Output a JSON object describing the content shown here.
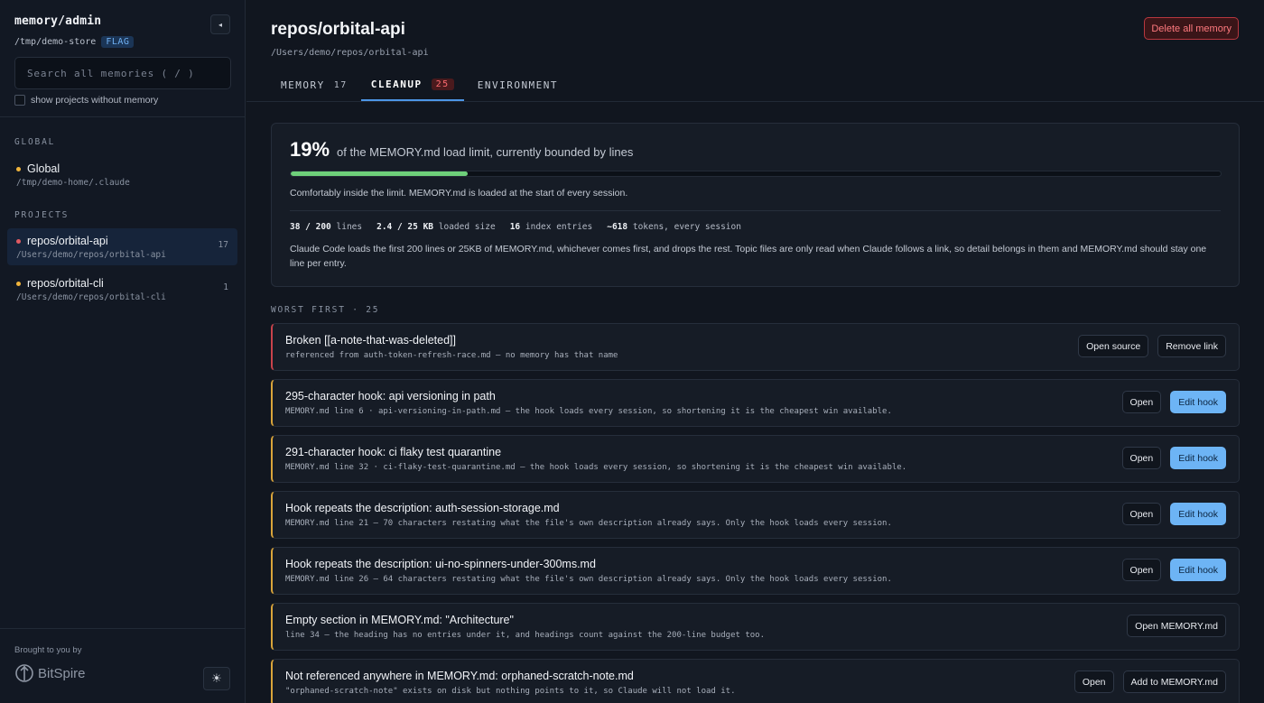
{
  "sidebar": {
    "app_title": "memory/admin",
    "store_path": "/tmp/demo-store",
    "flag_label": "FLAG",
    "collapse_icon": "◂",
    "search_placeholder": "Search all memories  ( / )",
    "show_without_memory_label": "show projects without memory",
    "global_section_label": "GLOBAL",
    "global_item": {
      "name": "Global",
      "path": "/tmp/demo-home/.claude",
      "dot_color": "#f0b43c"
    },
    "projects_section_label": "PROJECTS",
    "projects": [
      {
        "name": "repos/orbital-api",
        "path": "/Users/demo/repos/orbital-api",
        "count": "17",
        "dot_color": "#e05a62",
        "active": true
      },
      {
        "name": "repos/orbital-cli",
        "path": "/Users/demo/repos/orbital-cli",
        "count": "1",
        "dot_color": "#f0b43c",
        "active": false
      }
    ],
    "footer": {
      "brought_label": "Brought to you by",
      "logo_text": "BitSpire",
      "theme_icon": "☀"
    }
  },
  "header": {
    "title": "repos/orbital-api",
    "path": "/Users/demo/repos/orbital-api",
    "delete_label": "Delete all memory",
    "tabs": [
      {
        "label": "MEMORY",
        "count": "17"
      },
      {
        "label": "CLEANUP",
        "count": "25"
      },
      {
        "label": "ENVIRONMENT"
      }
    ]
  },
  "load_panel": {
    "percent": "19%",
    "percent_value": 0.19,
    "description": "of the MEMORY.md load limit, currently bounded by lines",
    "status_note": "Comfortably inside the limit. MEMORY.md is loaded at the start of every session.",
    "stats": [
      {
        "value": "38 / 200",
        "label": "lines"
      },
      {
        "value": "2.4 / 25 KB",
        "label": "loaded size"
      },
      {
        "value": "16",
        "label": "index entries"
      },
      {
        "value": "~618",
        "label": "tokens, every session"
      }
    ],
    "explanation": "Claude Code loads the first 200 lines or 25KB of MEMORY.md, whichever comes first, and drops the rest. Topic files are only read when Claude follows a link, so detail belongs in them and MEMORY.md should stay one line per entry."
  },
  "worst_first_label": "WORST FIRST · 25",
  "issues": [
    {
      "title": "Broken [[a-note-that-was-deleted]]",
      "detail": "referenced from auth-token-refresh-race.md — no memory has that name",
      "severity": "error",
      "actions": [
        "Open source",
        "Remove link"
      ],
      "primary": ""
    },
    {
      "title": "295-character hook: api versioning in path",
      "detail": "MEMORY.md line 6 · api-versioning-in-path.md — the hook loads every session, so shortening it is the cheapest win available.",
      "severity": "warning",
      "actions": [
        "Open"
      ],
      "primary": "Edit hook"
    },
    {
      "title": "291-character hook: ci flaky test quarantine",
      "detail": "MEMORY.md line 32 · ci-flaky-test-quarantine.md — the hook loads every session, so shortening it is the cheapest win available.",
      "severity": "warning",
      "actions": [
        "Open"
      ],
      "primary": "Edit hook"
    },
    {
      "title": "Hook repeats the description: auth-session-storage.md",
      "detail": "MEMORY.md line 21 — 70 characters restating what the file's own description already says. Only the hook loads every session.",
      "severity": "warning",
      "actions": [
        "Open"
      ],
      "primary": "Edit hook"
    },
    {
      "title": "Hook repeats the description: ui-no-spinners-under-300ms.md",
      "detail": "MEMORY.md line 26 — 64 characters restating what the file's own description already says. Only the hook loads every session.",
      "severity": "warning",
      "actions": [
        "Open"
      ],
      "primary": "Edit hook"
    },
    {
      "title": "Empty section in MEMORY.md: \"Architecture\"",
      "detail": "line 34 — the heading has no entries under it, and headings count against the 200-line budget too.",
      "severity": "warning",
      "actions": [
        "Open MEMORY.md"
      ],
      "primary": ""
    },
    {
      "title": "Not referenced anywhere in MEMORY.md: orphaned-scratch-note.md",
      "detail": "\"orphaned-scratch-note\" exists on disk but nothing points to it, so Claude will not load it.",
      "severity": "warning",
      "actions": [
        "Open",
        "Add to MEMORY.md"
      ],
      "primary": ""
    }
  ]
}
